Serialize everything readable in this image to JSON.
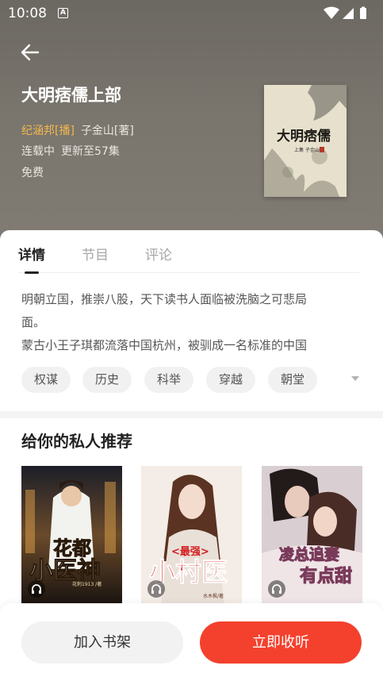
{
  "status_bar": {
    "time": "10:08",
    "indicator": "A"
  },
  "header": {
    "title": "大明痞儒上部",
    "narrator": "纪涵邦[播]",
    "author": "子金山[著]",
    "serial_status": "连载中",
    "update_info": "更新至57集",
    "price": "免费",
    "cover_title": "大明痞儒",
    "cover_subtitle": "上集 子金山"
  },
  "tabs": [
    {
      "label": "详情",
      "active": true
    },
    {
      "label": "节目",
      "active": false
    },
    {
      "label": "评论",
      "active": false
    }
  ],
  "intro": {
    "line1": "明朝立国，推崇八股，天下读书人面临被洗脑之可悲局",
    "line2": "面。",
    "line3": "蒙古小王子琪都流落中国杭州，被驯成一名标准的中国"
  },
  "tags": [
    "权谋",
    "历史",
    "科举",
    "穿越",
    "朝堂"
  ],
  "recommend": {
    "title": "给你的私人推荐",
    "books": [
      {
        "cover_text_1": "花都",
        "cover_text_2": "小医神",
        "cover_author": "花刺1913 /著"
      },
      {
        "cover_text_top": "<最强>",
        "cover_text_main": "小村医",
        "cover_author": "水木枫/著"
      },
      {
        "cover_text_1": "凌总追妻",
        "cover_text_2": "有点甜"
      }
    ]
  },
  "actions": {
    "add_shelf": "加入书架",
    "listen_now": "立即收听"
  },
  "colors": {
    "accent": "#f4412d",
    "narrator": "#f3b84c",
    "hero_bg": "#79756d"
  }
}
